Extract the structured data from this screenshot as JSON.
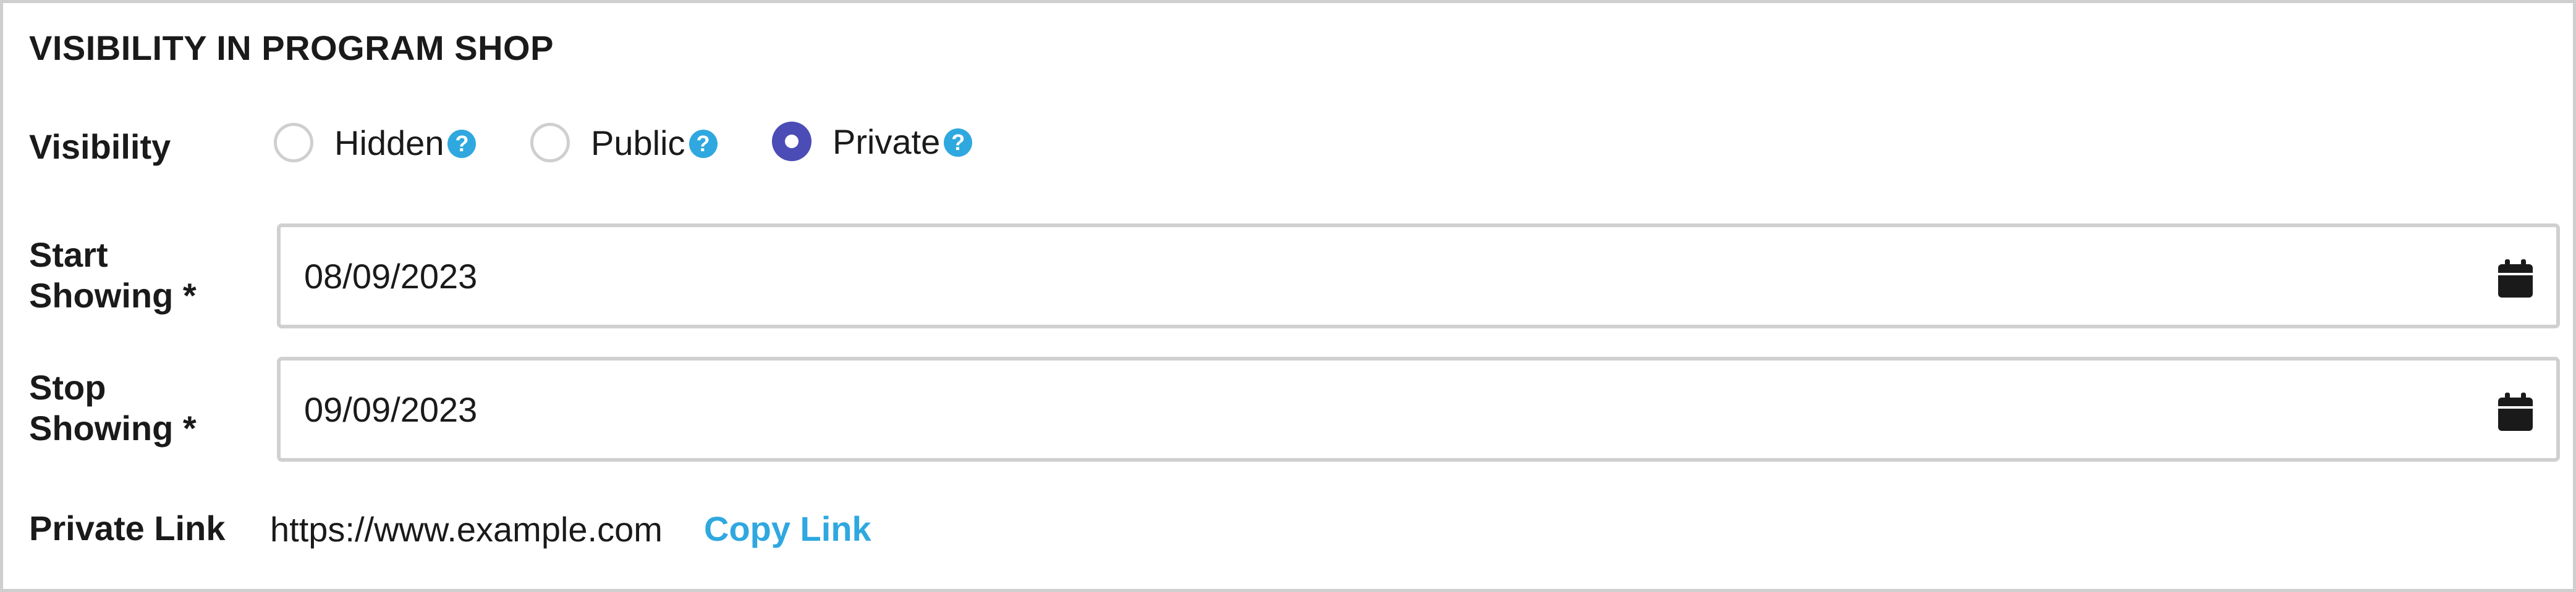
{
  "section": {
    "title": "VISIBILITY IN PROGRAM SHOP"
  },
  "visibility": {
    "label": "Visibility",
    "options": [
      {
        "label": "Hidden",
        "help_icon": "?",
        "checked": false
      },
      {
        "label": "Public",
        "help_icon": "?",
        "checked": false
      },
      {
        "label": "Private",
        "help_icon": "?",
        "checked": true
      }
    ],
    "selected": "Private"
  },
  "start_showing": {
    "label_line1": "Start",
    "label_line2": "Showing *",
    "value": "08/09/2023",
    "icon": "calendar-icon"
  },
  "stop_showing": {
    "label_line1": "Stop",
    "label_line2": "Showing *",
    "value": "09/09/2023",
    "icon": "calendar-icon"
  },
  "private_link": {
    "label": "Private Link",
    "url": "https://www.example.com",
    "copy_label": "Copy Link"
  },
  "colors": {
    "accent": "#4b4cb5",
    "link": "#2fa8e0",
    "border": "#d0d0d0"
  }
}
